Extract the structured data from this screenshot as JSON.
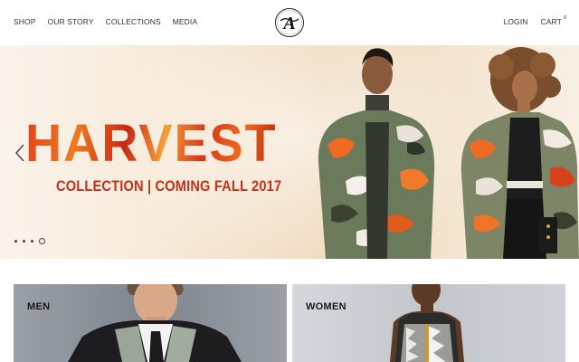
{
  "nav": {
    "left": [
      {
        "label": "SHOP"
      },
      {
        "label": "OUR STORY"
      },
      {
        "label": "COLLECTIONS"
      },
      {
        "label": "MEDIA"
      }
    ],
    "login_label": "LOGIN",
    "cart_label": "CART",
    "cart_count": "0"
  },
  "logo": {
    "icon": "brand-monogram-logo",
    "letter": "A"
  },
  "hero": {
    "title": "HARVEST",
    "subtitle": "COLLECTION | COMING FALL 2017",
    "slide_count": 4,
    "active_slide": 4,
    "colors": {
      "title_accent": "#e0401c",
      "subtitle": "#c4301a",
      "background": "#f3e3cd"
    }
  },
  "categories": [
    {
      "label": "MEN"
    },
    {
      "label": "WOMEN"
    }
  ]
}
